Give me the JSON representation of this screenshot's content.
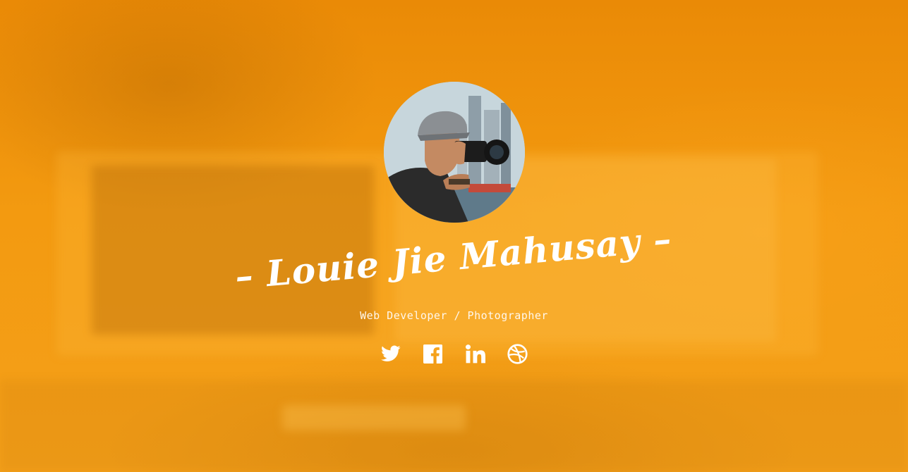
{
  "profile": {
    "name": "Louie Jie Mahusay",
    "name_prefix": "–",
    "name_suffix": "–",
    "subtitle": "Web Developer / Photographer",
    "avatar_icon": "photographer-avatar"
  },
  "social": [
    {
      "name": "twitter",
      "icon": "twitter-icon"
    },
    {
      "name": "facebook",
      "icon": "facebook-icon"
    },
    {
      "name": "linkedin",
      "icon": "linkedin-icon"
    },
    {
      "name": "dribbble",
      "icon": "dribbble-icon"
    }
  ],
  "colors": {
    "background": "#f59a12",
    "text": "#ffffff"
  }
}
